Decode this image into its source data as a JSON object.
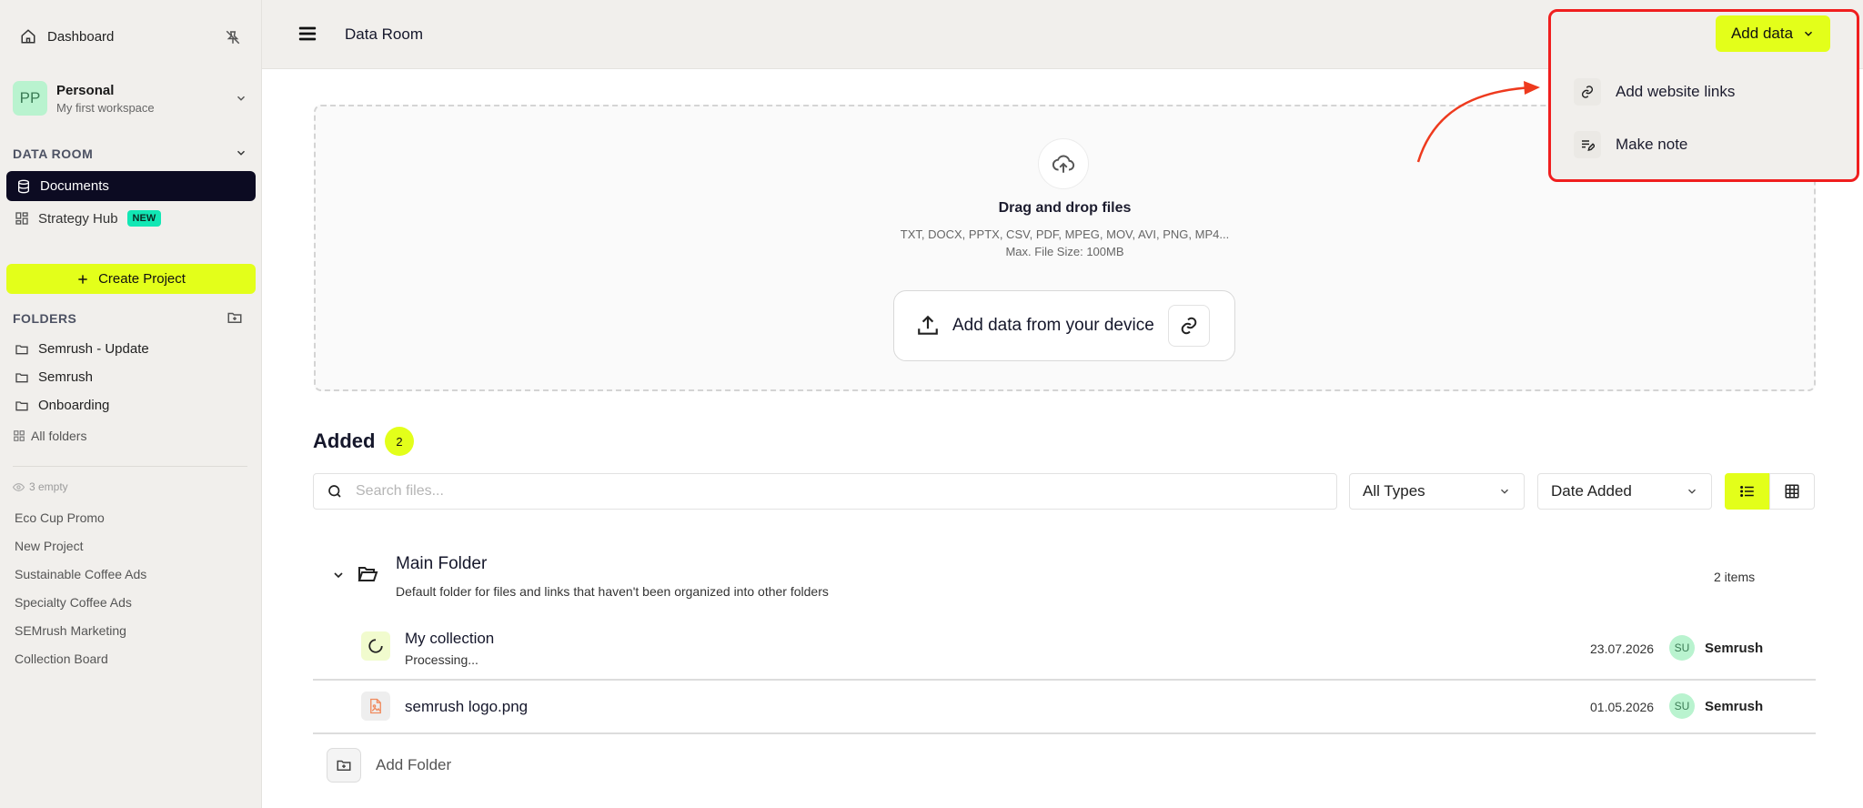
{
  "sidebar": {
    "dashboard_label": "Dashboard",
    "workspace": {
      "initials": "PP",
      "name": "Personal",
      "subtitle": "My first workspace"
    },
    "data_room_heading": "DATA ROOM",
    "nav": [
      {
        "label": "Documents",
        "icon": "database-icon",
        "active": true
      },
      {
        "label": "Strategy Hub",
        "icon": "grid-icon",
        "badge": "NEW"
      }
    ],
    "create_project_label": "Create Project",
    "folders_heading": "FOLDERS",
    "folders": [
      "Semrush - Update",
      "Semrush",
      "Onboarding"
    ],
    "all_folders_label": "All folders",
    "empty_label": "3 empty",
    "projects": [
      "Eco Cup Promo",
      "New Project",
      "Sustainable Coffee Ads",
      "Specialty Coffee Ads",
      "SEMrush Marketing",
      "Collection Board"
    ]
  },
  "header": {
    "title": "Data Room",
    "add_data_label": "Add data"
  },
  "add_data_menu": [
    {
      "label": "Add website links",
      "icon": "link-icon"
    },
    {
      "label": "Make note",
      "icon": "note-edit-icon"
    }
  ],
  "dropzone": {
    "title": "Drag and drop files",
    "formats": "TXT, DOCX, PPTX, CSV, PDF, MPEG, MOV, AVI, PNG, MP4...",
    "max_size": "Max. File Size: 100MB",
    "button_label": "Add data from your device"
  },
  "added": {
    "heading": "Added",
    "count": "2",
    "search_placeholder": "Search files...",
    "type_filter": "All Types",
    "sort": "Date Added"
  },
  "main_folder": {
    "title": "Main Folder",
    "description": "Default folder for files and links that haven't been organized into other folders",
    "items_count": "2 items"
  },
  "files": [
    {
      "name": "My collection",
      "status": "Processing...",
      "date": "23.07.2026",
      "owner_initials": "SU",
      "owner": "Semrush"
    },
    {
      "name": "semrush logo.png",
      "status": "",
      "date": "01.05.2026",
      "owner_initials": "SU",
      "owner": "Semrush"
    }
  ],
  "add_folder_label": "Add Folder",
  "colors": {
    "accent": "#E3FF1A",
    "nav_active": "#0C0B22",
    "highlight_border": "#F01E1E",
    "new_badge": "#12E7B4",
    "arrow": "#EE3A1E"
  }
}
